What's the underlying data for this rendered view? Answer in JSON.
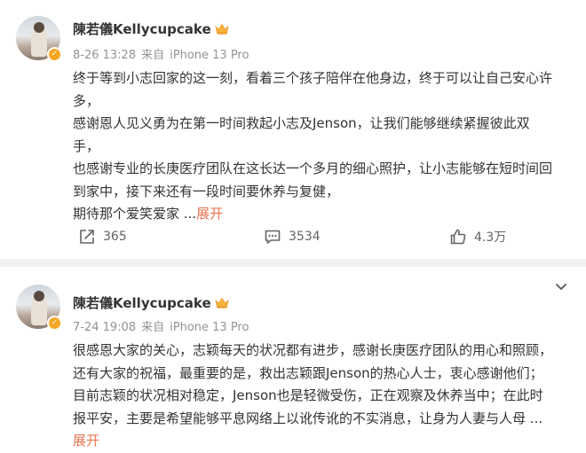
{
  "posts": [
    {
      "author": "陳若儀Kellycupcake",
      "date": "8-26 13:28",
      "source_prefix": "来自",
      "device": "iPhone 13 Pro",
      "lines": [
        "终于等到小志回家的这一刻，看着三个孩子陪伴在他身边，终于可以让自己安心许",
        "多，",
        "感谢恩人见义勇为在第一时间救起小志及Jenson，让我们能够继续紧握彼此双",
        "手，",
        "也感谢专业的长庚医疗团队在这长达一个多月的细心照护，让小志能够在短时间回",
        "到家中，接下来还有一段时间要休养与复健，",
        "期待那个爱笑爱家"
      ],
      "ellipsis": "...",
      "expand_label": "展开",
      "shares": "365",
      "comments": "3534",
      "likes": "4.3万"
    },
    {
      "author": "陳若儀Kellycupcake",
      "date": "7-24 19:08",
      "source_prefix": "来自",
      "device": "iPhone 13 Pro",
      "lines": [
        "很感恩大家的关心，志颖每天的状况都有进步，感谢长庚医疗团队的用心和照顾，",
        "还有大家的祝福，最重要的是，救出志颖跟Jenson的热心人士，衷心感谢他们；",
        "目前志颖的状况相对稳定，Jenson也是轻微受伤，正在观察及休养当中；在此时",
        "报平安，主要是希望能够平息网络上以讹传讹的不实消息，让身为人妻与人母"
      ],
      "ellipsis": "...",
      "expand_label": "展开"
    }
  ],
  "icons": {
    "verified": "verified-badge-icon",
    "crown": "crown-icon",
    "share": "share-icon",
    "comment": "comment-icon",
    "like": "thumbs-up-icon",
    "more": "chevron-down-icon"
  },
  "colors": {
    "expand": "#eb7350",
    "meta": "#939393",
    "action": "#636363",
    "verified": "#f5a623"
  }
}
